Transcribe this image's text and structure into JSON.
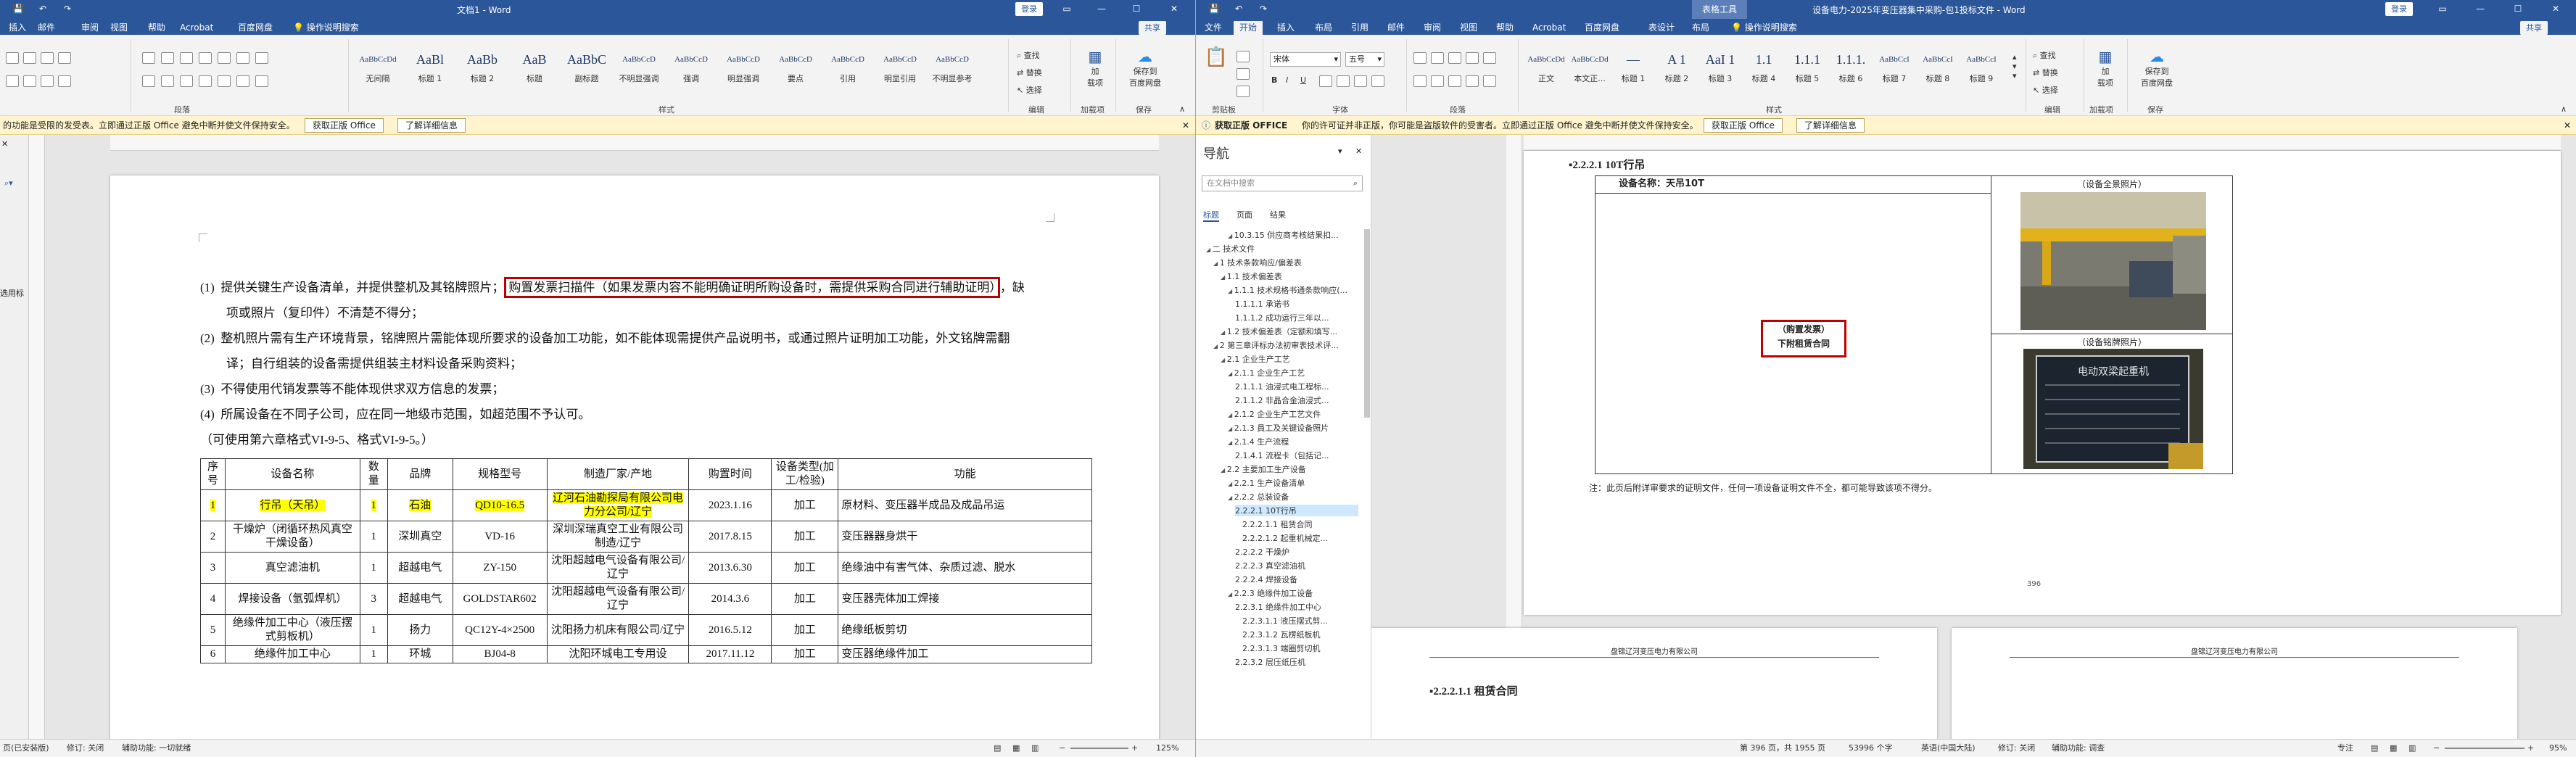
{
  "left_window": {
    "title": "文档1 - Word",
    "signin": "登录",
    "share": "共享",
    "menu_tabs": [
      "插入",
      "邮件",
      "审阅",
      "视图",
      "帮助",
      "Acrobat",
      "百度网盘"
    ],
    "tell_me": "操作说明搜索",
    "ribbon": {
      "styles": [
        {
          "preview": "AaBbCcDd",
          "name": "无间隔"
        },
        {
          "preview": "AaBl",
          "name": "标题 1"
        },
        {
          "preview": "AaBb",
          "name": "标题 2"
        },
        {
          "preview": "AaB",
          "name": "标题"
        },
        {
          "preview": "AaBbC",
          "name": "副标题"
        },
        {
          "preview": "AaBbCcD",
          "name": "不明显强调"
        },
        {
          "preview": "AaBbCcD",
          "name": "强调"
        },
        {
          "preview": "AaBbCcD",
          "name": "明显强调"
        },
        {
          "preview": "AaBbCcD",
          "name": "要点"
        },
        {
          "preview": "AaBbCcD",
          "name": "引用"
        },
        {
          "preview": "AaBbCcD",
          "name": "明显引用"
        },
        {
          "preview": "AaBbCcD",
          "name": "不明显参考"
        }
      ],
      "editing": [
        "查找",
        "替换",
        "选择"
      ],
      "groups": [
        "段落",
        "样式",
        "编辑",
        "保存",
        "加载项"
      ],
      "save_btn": [
        "保存到",
        "百度网盘"
      ],
      "load_btn": [
        "加",
        "载项"
      ]
    },
    "message": "的功能是受限的发受表。立即通过正版 Office 避免中断并使文件保持安全。",
    "msg_buttons": [
      "获取正版 Office",
      "了解详细信息"
    ],
    "sidebar_fragment": "选用标",
    "document": {
      "items": [
        {
          "no": "(1)",
          "pre": "提供关键生产设备清单，并提供整机及其铭牌照片；",
          "boxed": "购置发票扫描件（如果发票内容不能明确证明所购设备时，需提供采购合同进行辅助证明）",
          "post": "，缺"
        },
        {
          "no": "",
          "pre": "项或照片（复印件）不清楚不得分；"
        },
        {
          "no": "(2)",
          "pre": "整机照片需有生产环境背景，铭牌照片需能体现所要求的设备加工功能，如不能体现需提供产品说明书，或通过照片证明加工功能，外文铭牌需翻"
        },
        {
          "no": "",
          "pre": "译；自行组装的设备需提供组装主材料设备采购资料；"
        },
        {
          "no": "(3)",
          "pre": "不得使用代销发票等不能体现供求双方信息的发票；"
        },
        {
          "no": "(4)",
          "pre": "所属设备在不同子公司，应在同一地级市范围，如超范围不予认可。"
        },
        {
          "no": "",
          "pre": "（可使用第六章格式VI-9-5、格式VI-9-5。）"
        }
      ],
      "table_headers": [
        "序号",
        "设备名称",
        "数量",
        "品牌",
        "规格型号",
        "制造厂家/产地",
        "购置时间",
        "设备类型(加工/检验)",
        "功能"
      ],
      "table_rows": [
        [
          "1",
          "行吊（天吊）",
          "1",
          "石油",
          "QD10-16.5",
          "辽河石油勘探局有限公司电力分公司/辽宁",
          "2023.1.16",
          "加工",
          "原材料、变压器半成品及成品吊运"
        ],
        [
          "2",
          "干燥炉（闭循环热风真空干燥设备）",
          "1",
          "深圳真空",
          "VD-16",
          "深圳深瑞真空工业有限公司制造/辽宁",
          "2017.8.15",
          "加工",
          "变压器器身烘干"
        ],
        [
          "3",
          "真空滤油机",
          "1",
          "超越电气",
          "ZY-150",
          "沈阳超越电气设备有限公司/辽宁",
          "2013.6.30",
          "加工",
          "绝缘油中有害气体、杂质过滤、脱水"
        ],
        [
          "4",
          "焊接设备（氩弧焊机）",
          "3",
          "超越电气",
          "GOLDSTAR602",
          "沈阳超越电气设备有限公司/辽宁",
          "2014.3.6",
          "加工",
          "变压器壳体加工焊接"
        ],
        [
          "5",
          "绝缘件加工中心（液压摆式剪板机）",
          "1",
          "扬力",
          "QC12Y-4×2500",
          "沈阳扬力机床有限公司/辽宁",
          "2016.5.12",
          "加工",
          "绝缘纸板剪切"
        ],
        [
          "6",
          "绝缘件加工中心",
          "1",
          "环城",
          "BJ04-8",
          "沈阳环城电工专用设",
          "2017.11.12",
          "加工",
          "变压器绝缘件加工"
        ]
      ]
    },
    "status": [
      "页(已安装版)",
      "修订: 关闭",
      "辅助功能: 一切就绪"
    ],
    "zoom": "125%"
  },
  "right_window": {
    "title": "设备电力-2025年变压器集中采购-包1投标文件 - Word",
    "context_tab": "表格工具",
    "signin": "登录",
    "share": "共享",
    "menu_tabs": [
      "文件",
      "开始",
      "插入",
      "布局",
      "引用",
      "邮件",
      "审阅",
      "视图",
      "帮助",
      "Acrobat",
      "百度网盘",
      "表设计",
      "布局"
    ],
    "tell_me": "操作说明搜索",
    "font": {
      "name": "宋体",
      "size": "五号"
    },
    "styles": [
      {
        "preview": "AaBbCcDd",
        "name": "正文"
      },
      {
        "preview": "AaBbCcDd",
        "name": "本文正..."
      },
      {
        "preview": "—",
        "name": "标题 1"
      },
      {
        "preview": "A 1",
        "name": "标题 2"
      },
      {
        "preview": "AaI 1",
        "name": "标题 3"
      },
      {
        "preview": "1.1",
        "name": "标题 4"
      },
      {
        "preview": "1.1.1",
        "name": "标题 5"
      },
      {
        "preview": "1.1.1.",
        "name": "标题 6"
      },
      {
        "preview": "AaBbCcI",
        "name": "标题 7"
      },
      {
        "preview": "AaBbCcI",
        "name": "标题 8"
      },
      {
        "preview": "AaBbCcI",
        "name": "标题 9"
      }
    ],
    "groups": [
      "剪贴板",
      "字体",
      "段落",
      "样式",
      "编辑",
      "加载项",
      "保存"
    ],
    "editing": [
      "查找",
      "替换",
      "选择"
    ],
    "message_title": "获取正版 OFFICE",
    "message": "你的许可证并非正版，你可能是盗版软件的受害者。立即通过正版 Office 避免中断并使文件保持安全。",
    "msg_buttons": [
      "获取正版 Office",
      "了解详细信息"
    ],
    "nav": {
      "title": "导航",
      "search_placeholder": "在文档中搜索",
      "tabs": [
        "标题",
        "页面",
        "结果"
      ],
      "items": [
        {
          "text": "10.3.15 供应商考核结果扣...",
          "level": 3,
          "selected": false
        },
        {
          "text": "二 技术文件",
          "level": 0,
          "selected": false
        },
        {
          "text": "1 技术条款响应/偏差表",
          "level": 1,
          "selected": false
        },
        {
          "text": "1.1 技术偏差表",
          "level": 2,
          "selected": false
        },
        {
          "text": "1.1.1 技术规格书通条款响应(...",
          "level": 3,
          "selected": false
        },
        {
          "text": "1.1.1.1 承诺书",
          "level": 4,
          "selected": false
        },
        {
          "text": "1.1.1.2 成功运行三年以...",
          "level": 4,
          "selected": false
        },
        {
          "text": "1.2 技术偏差表（定额和填写...",
          "level": 2,
          "selected": false
        },
        {
          "text": "2 第三章评标办法初审表技术评...",
          "level": 1,
          "selected": false
        },
        {
          "text": "2.1 企业生产工艺",
          "level": 2,
          "selected": false
        },
        {
          "text": "2.1.1 企业生产工艺",
          "level": 3,
          "selected": false
        },
        {
          "text": "2.1.1.1 油浸式电工程标...",
          "level": 4,
          "selected": false
        },
        {
          "text": "2.1.1.2 非晶合金油浸式...",
          "level": 4,
          "selected": false
        },
        {
          "text": "2.1.2 企业生产工艺文件",
          "level": 3,
          "selected": false
        },
        {
          "text": "2.1.3 員工及关键设备照片",
          "level": 3,
          "selected": false
        },
        {
          "text": "2.1.4 生产流程",
          "level": 3,
          "selected": false
        },
        {
          "text": "2.1.4.1 流程卡（包括记...",
          "level": 4,
          "selected": false
        },
        {
          "text": "2.2 主要加工生产设备",
          "level": 2,
          "selected": false
        },
        {
          "text": "2.2.1 生产设备清单",
          "level": 3,
          "selected": false
        },
        {
          "text": "2.2.2 总装设备",
          "level": 3,
          "selected": false
        },
        {
          "text": "2.2.2.1 10T行吊",
          "level": 4,
          "selected": true
        },
        {
          "text": "2.2.2.1.1 租赁合同",
          "level": 5,
          "selected": false
        },
        {
          "text": "2.2.2.1.2 起重机械定...",
          "level": 5,
          "selected": false
        },
        {
          "text": "2.2.2.2 干燥炉",
          "level": 4,
          "selected": false
        },
        {
          "text": "2.2.2.3 真空滤油机",
          "level": 4,
          "selected": false
        },
        {
          "text": "2.2.2.4 焊接设备",
          "level": 4,
          "selected": false
        },
        {
          "text": "2.2.3 绝缘件加工设备",
          "level": 3,
          "selected": false
        },
        {
          "text": "2.2.3.1 绝缘件加工中心",
          "level": 4,
          "selected": false
        },
        {
          "text": "2.2.3.1.1 液压摆式剪...",
          "level": 5,
          "selected": false
        },
        {
          "text": "2.2.3.1.2 瓦楞纸板机",
          "level": 5,
          "selected": false
        },
        {
          "text": "2.2.3.1.3 端圈剪切机",
          "level": 5,
          "selected": false
        },
        {
          "text": "2.2.3.2 层压纸压机",
          "level": 4,
          "selected": false
        }
      ]
    },
    "document": {
      "heading": "2.2.2.1 10T行吊",
      "device_name": "设备名称：天吊10T",
      "photo_overall": "（设备全景照片）",
      "photo_nameplate": "（设备铭牌照片）",
      "invoice_label": "（购置发票）",
      "lease_label": "下附租赁合同",
      "note": "注：此页后附详审要求的证明文件，任何一项设备证明文件不全，都可能导致该项不得分。",
      "page_number": "396",
      "nameplate_text": "电动双梁起重机",
      "next_header_left": "盘锦辽河变压电力有限公司",
      "next_header_right": "盘锦辽河变压电力有限公司",
      "next_heading": "2.2.2.1.1 租赁合同"
    },
    "status": [
      "第 396 页，共 1955 页",
      "53996 个字",
      "英语(中国大陆)",
      "修订: 关闭",
      "辅助功能: 调查"
    ],
    "zoom": "95%",
    "focus": "专注"
  },
  "colors": {
    "brand": "#2b579a",
    "highlight": "#ffff00",
    "annotation_box": "#c00000",
    "message_bg": "#fff4ce"
  }
}
